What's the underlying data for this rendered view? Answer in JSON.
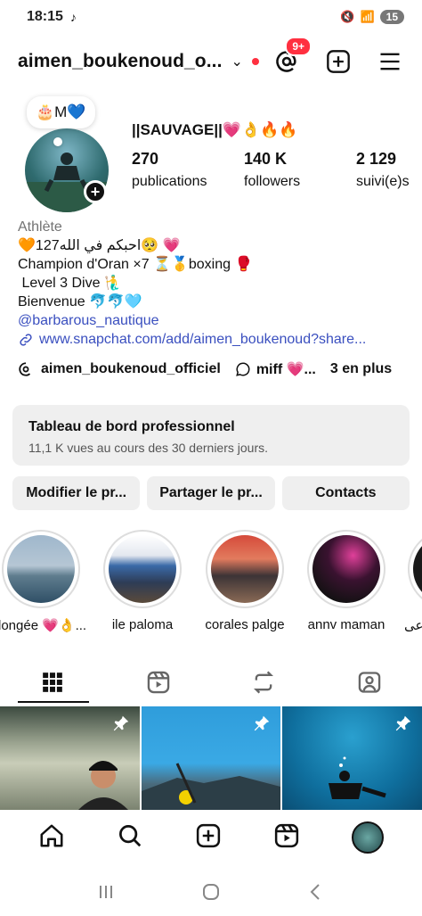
{
  "status_bar": {
    "time": "18:15",
    "app_icon": "tiktok-icon",
    "battery": "15"
  },
  "header": {
    "username": "aimen_boukenoud_o...",
    "threads_badge": "9+"
  },
  "profile": {
    "note": "🎂M💙",
    "display_name": "||SAUVAGE||💗👌🔥🔥",
    "stats": [
      {
        "value": "270",
        "label": "publications"
      },
      {
        "value": "140 K",
        "label": "followers"
      },
      {
        "value": "2 129",
        "label": "suivi(e)s"
      }
    ],
    "category": "Athlète",
    "bio_lines": [
      "🧡127احبكم في الله🥺 💗",
      "Champion d'Oran ×7 ⏳🥇boxing 🥊",
      " Level 3 Dive 🧜‍♂️",
      "Bienvenue 🐬🐬🩵"
    ],
    "mention": "@barbarous_nautique",
    "link": "www.snapchat.com/add/aimen_boukenoud?share...",
    "threads_handle": "aimen_boukenoud_officiel",
    "note_chip": "miff 💗...",
    "more": "3 en plus"
  },
  "dashboard": {
    "title": "Tableau de bord professionnel",
    "subtitle": "11,1 K vues au cours des 30 derniers jours."
  },
  "actions": {
    "edit": "Modifier le pr...",
    "share": "Partager le pr...",
    "contacts": "Contacts"
  },
  "highlights": [
    {
      "label": "longée 💗👌..."
    },
    {
      "label": "ile paloma"
    },
    {
      "label": "corales palge"
    },
    {
      "label": "annv maman"
    },
    {
      "label": "ساعی"
    }
  ],
  "colors": {
    "accent_red": "#ff3040",
    "link_blue": "#3a4fbf",
    "button_bg": "#efefef"
  }
}
